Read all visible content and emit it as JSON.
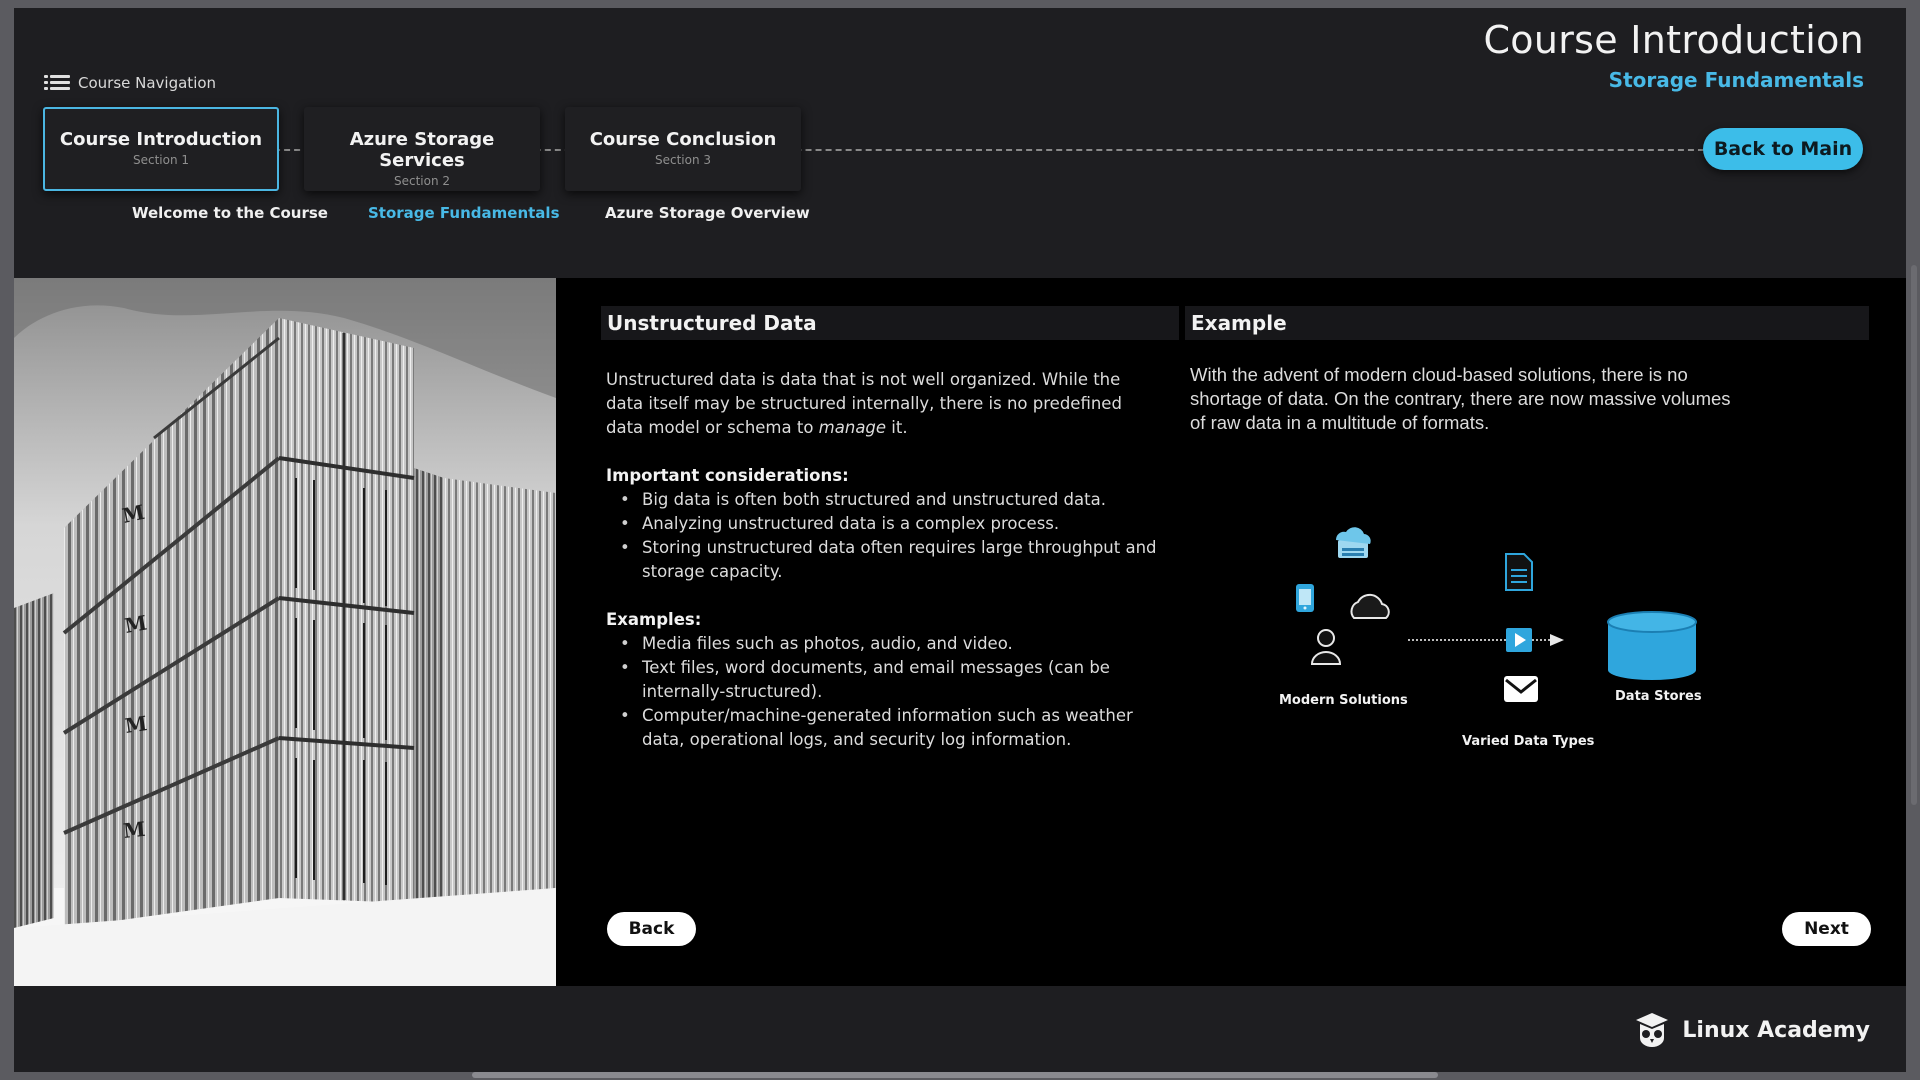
{
  "header": {
    "title": "Course Introduction",
    "subtitle": "Storage Fundamentals",
    "nav_label": "Course Navigation",
    "back_main_label": "Back to Main"
  },
  "steps": [
    {
      "title": "Course Introduction",
      "section": "Section 1",
      "caption": "Welcome to the Course",
      "active": true
    },
    {
      "title": "Azure Storage Services",
      "section": "Section 2",
      "caption": "Storage Fundamentals",
      "current": true
    },
    {
      "title": "Course Conclusion",
      "section": "Section 3",
      "caption": "Azure Storage Overview"
    }
  ],
  "left_panel": {
    "heading": "Unstructured Data",
    "intro_pre": "Unstructured data is data that is not well organized. While the data itself may be structured internally, there is no predefined data model or schema to ",
    "intro_em": "manage",
    "intro_post": " it.",
    "considerations_label": "Important considerations:",
    "considerations": [
      "Big data is often both structured and unstructured data.",
      "Analyzing unstructured data is a complex process.",
      "Storing unstructured data often requires large throughput and storage capacity."
    ],
    "examples_label": "Examples:",
    "examples": [
      "Media files such as photos, audio, and video.",
      "Text files, word documents, and email messages (can be internally-structured).",
      "Computer/machine-generated information such as weather data, operational logs, and security log information."
    ]
  },
  "right_panel": {
    "heading": "Example",
    "text": "With the advent of modern cloud-based solutions, there is no shortage of data. On the contrary, there are now massive volumes of raw data in a multitude of formats."
  },
  "diagram": {
    "source_label": "Modern Solutions",
    "types_label": "Varied Data Types",
    "target_label": "Data Stores",
    "accent_color": "#2fa6dd"
  },
  "buttons": {
    "back": "Back",
    "next": "Next"
  },
  "footer": {
    "brand": "Linux Academy"
  }
}
